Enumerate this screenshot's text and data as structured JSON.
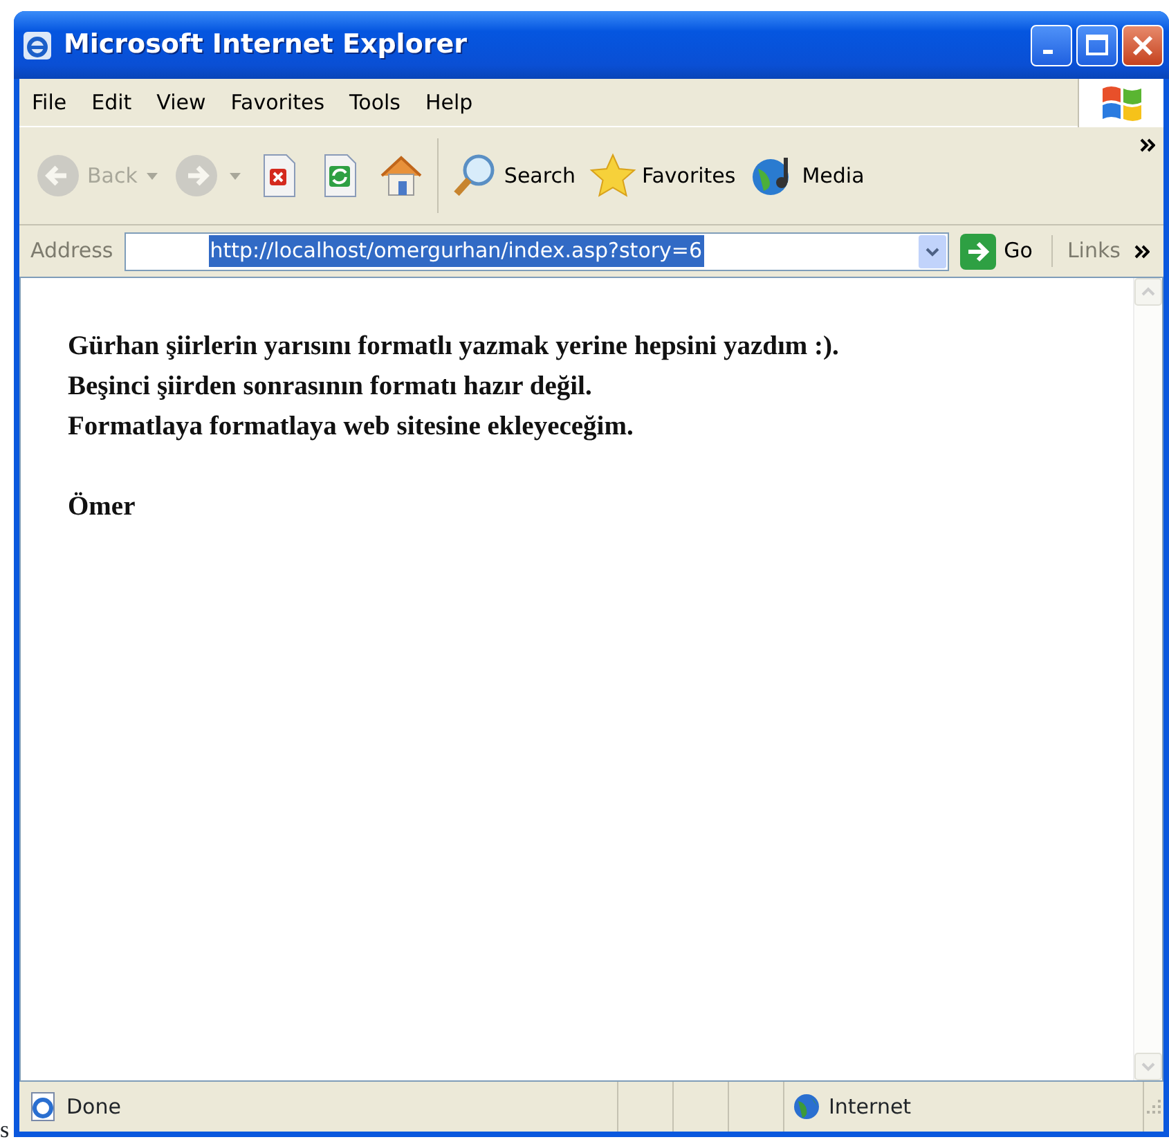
{
  "window": {
    "title": "Microsoft Internet Explorer"
  },
  "menu": [
    {
      "label": "File"
    },
    {
      "label": "Edit"
    },
    {
      "label": "View"
    },
    {
      "label": "Favorites"
    },
    {
      "label": "Tools"
    },
    {
      "label": "Help"
    }
  ],
  "toolbar": [
    {
      "kind": "back",
      "label": "Back",
      "disabled": true
    },
    {
      "kind": "forward",
      "disabled": true
    },
    {
      "kind": "stop",
      "disabled": false
    },
    {
      "kind": "refresh",
      "disabled": false
    },
    {
      "kind": "home",
      "disabled": false
    },
    {
      "kind": "search",
      "label": "Search",
      "disabled": false
    },
    {
      "kind": "favorites",
      "label": "Favorites",
      "disabled": false
    },
    {
      "kind": "media",
      "label": "Media",
      "disabled": false
    }
  ],
  "address_bar": {
    "label": "Address",
    "value": "http://localhost/omergurhan/index.asp?story=6",
    "selected": true,
    "go_label": "Go",
    "links_label": "Links"
  },
  "content": {
    "paragraphs": [
      {
        "lines": [
          "Gürhan şiirlerin yarısını formatlı yazmak yerine hepsini yazdım :).",
          "Beşinci şiirden sonrasının formatı hazır değil.",
          "Formatlaya formatlaya web sitesine ekleyeceğim."
        ]
      },
      {
        "lines": [
          "Ömer"
        ]
      }
    ]
  },
  "status_bar": {
    "status": "Done",
    "zone": "Internet"
  },
  "background_text": "s"
}
